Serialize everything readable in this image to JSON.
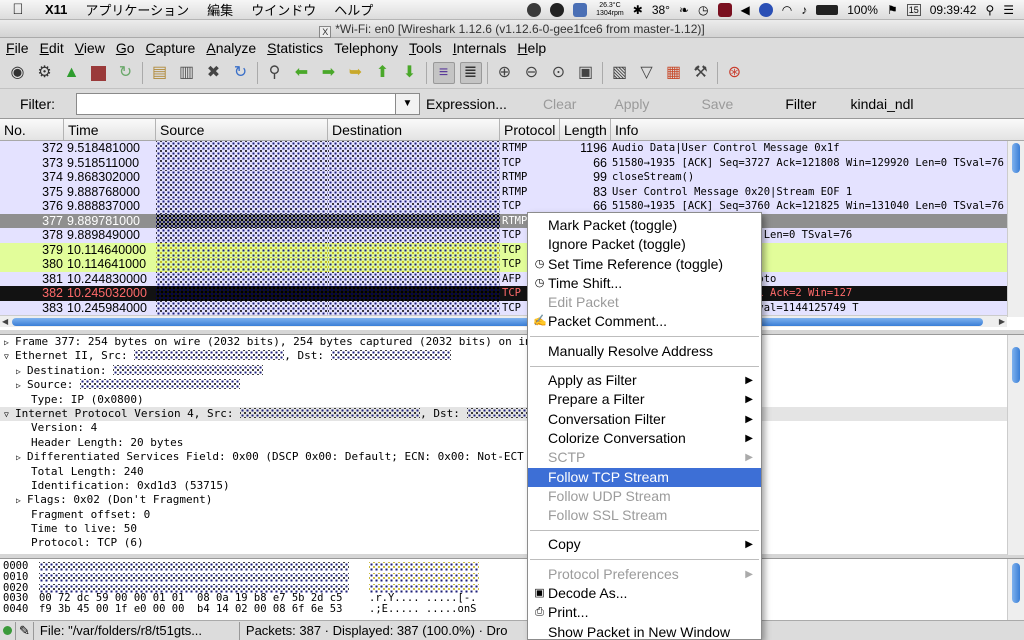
{
  "macbar": {
    "app_name": "X11",
    "menus": [
      "アプリケーション",
      "編集",
      "ウインドウ",
      "ヘルプ"
    ],
    "weather_temp": "26.3°C",
    "weather_wind": "1304rpm",
    "cpu_temp": "38°",
    "battery": "100%",
    "time": "09:39:42",
    "date_day": "15"
  },
  "title": "*Wi-Fi: en0   [Wireshark 1.12.6  (v1.12.6-0-gee1fce6 from master-1.12)]",
  "menubar": {
    "items": [
      {
        "key": "F",
        "rest": "ile"
      },
      {
        "key": "E",
        "rest": "dit"
      },
      {
        "key": "V",
        "rest": "iew"
      },
      {
        "key": "G",
        "rest": "o"
      },
      {
        "key": "C",
        "rest": "apture"
      },
      {
        "key": "A",
        "rest": "nalyze"
      },
      {
        "key": "S",
        "rest": "tatistics"
      },
      {
        "key": "",
        "rest": "Telephony"
      },
      {
        "key": "T",
        "rest": "ools"
      },
      {
        "key": "I",
        "rest": "nternals"
      },
      {
        "key": "H",
        "rest": "elp"
      }
    ]
  },
  "toolbar": {
    "icons": [
      "interface-list-icon",
      "capture-options-icon",
      "start-capture-icon",
      "stop-capture-icon",
      "restart-capture-icon",
      "open-file-icon",
      "save-file-icon",
      "close-file-icon",
      "reload-icon",
      "find-packet-icon",
      "go-back-icon",
      "go-forward-icon",
      "go-to-packet-icon",
      "go-first-icon",
      "go-last-icon",
      "colorize-icon",
      "autoscroll-icon",
      "zoom-in-icon",
      "zoom-out-icon",
      "zoom-normal-icon",
      "resize-columns-icon",
      "capture-filters-icon",
      "display-filters-icon",
      "coloring-rules-icon",
      "preferences-icon",
      "help-icon"
    ]
  },
  "filterbar": {
    "label": "Filter:",
    "value": "",
    "expression": "Expression...",
    "clear": "Clear",
    "apply": "Apply",
    "save": "Save",
    "filter_btn": "Filter",
    "saved_filter": "kindai_ndl"
  },
  "packet_list": {
    "columns": [
      "No.",
      "Time",
      "Source",
      "Destination",
      "Protocol",
      "Length",
      "Info"
    ],
    "rows": [
      {
        "no": "372",
        "time": "9.518481000",
        "proto": "RTMP",
        "len": "1196",
        "info": "Audio Data|User Control Message 0x1f",
        "bg": "#e4e2ff",
        "fg": "#000",
        "noise": "normal"
      },
      {
        "no": "373",
        "time": "9.518511000",
        "proto": "TCP",
        "len": "66",
        "info": "51580→1935 [ACK] Seq=3727 Ack=121808 Win=129920 Len=0 TSval=76",
        "bg": "#e4e2ff",
        "fg": "#000",
        "noise": "normal"
      },
      {
        "no": "374",
        "time": "9.868302000",
        "proto": "RTMP",
        "len": "99",
        "info": "closeStream()",
        "bg": "#e4e2ff",
        "fg": "#000",
        "noise": "normal"
      },
      {
        "no": "375",
        "time": "9.888768000",
        "proto": "RTMP",
        "len": "83",
        "info": "User Control Message 0x20|Stream EOF 1",
        "bg": "#e4e2ff",
        "fg": "#000",
        "noise": "normal"
      },
      {
        "no": "376",
        "time": "9.888837000",
        "proto": "TCP",
        "len": "66",
        "info": "51580→1935 [ACK] Seq=3760 Ack=121825 Win=131040 Len=0 TSval=76",
        "bg": "#e4e2ff",
        "fg": "#000",
        "noise": "normal"
      },
      {
        "no": "377",
        "time": "9.889781000",
        "proto": "RTMP",
        "len": "",
        "info": "y,Stop')",
        "bg": "#8f8f8f",
        "fg": "#fff",
        "noise": "dense"
      },
      {
        "no": "378",
        "time": "9.889849000",
        "proto": "TCP",
        "len": "",
        "info": "0 Ack=122013 Win=130880 Len=0 TSval=76",
        "bg": "#e4e2ff",
        "fg": "#000",
        "noise": "normal"
      },
      {
        "no": "379",
        "time": "10.114640000",
        "proto": "TCP",
        "len": "",
        "info": "k=1 Win=8192 Len=0",
        "bg": "#e2fd9a",
        "fg": "#000",
        "noise": "yel"
      },
      {
        "no": "380",
        "time": "10.114641000",
        "proto": "TCP",
        "len": "",
        "info": "k=1 Win=8192 Len=0",
        "bg": "#e2fd9a",
        "fg": "#000",
        "noise": "yel"
      },
      {
        "no": "381",
        "time": "10.244830000",
        "proto": "AFP",
        "len": "",
        "info": "st: Vol=1 Did=2 Name=photo",
        "bg": "#e4e2ff",
        "fg": "#000",
        "noise": "normal"
      },
      {
        "no": "382",
        "time": "10.245032000",
        "proto": "TCP",
        "len": "",
        "info": "nt] 80→51052 [ACK] Seq=1 Ack=2 Win=127",
        "bg": "#121212",
        "fg": "#ff6a6a",
        "noise": "dense"
      },
      {
        "no": "383",
        "time": "10.245984000",
        "proto": "TCP",
        "len": "",
        "info": "ck=41 Win=4094 Len=0 TSval=1144125749 T",
        "bg": "#e4e2ff",
        "fg": "#000",
        "noise": "normal"
      }
    ]
  },
  "details": {
    "frame": "Frame 377: 254 bytes on wire (2032 bits), 254 bytes captured (2032 bits) on inte",
    "eth_src": "Ethernet II, Src:",
    "eth_dst": "Dst:",
    "eth_dest": "Destination:",
    "eth_source": "Source:",
    "eth_type": "Type: IP (0x0800)",
    "ip_src": "Internet Protocol Version 4, Src:",
    "ip_dst": "Dst:",
    "version": "Version: 4",
    "header_len": "Header Length: 20 bytes",
    "dsfield": "Differentiated Services Field: 0x00 (DSCP 0x00: Default; ECN: 0x00: Not-ECT (",
    "total_len": "Total Length: 240",
    "ident": "Identification: 0xd1d3 (53715)",
    "flags": "Flags: 0x02 (Don't Fragment)",
    "frag": "Fragment offset: 0",
    "ttl": "Time to live: 50",
    "proto": "Protocol: TCP (6)"
  },
  "bytes": {
    "rows": [
      {
        "off": "0000",
        "hex": "",
        "asc": ""
      },
      {
        "off": "0010",
        "hex": "",
        "asc": ""
      },
      {
        "off": "0020",
        "hex": "",
        "asc": ""
      },
      {
        "off": "0030",
        "hex": "00 72 dc 59 00 00 01 01  08 0a 19 b8 e7 5b 2d c5",
        "asc": ".r.Y.... .....[-."
      },
      {
        "off": "0040",
        "hex": "f9 3b 45 00 1f e0 00 00  b4 14 02 00 08 6f 6e 53",
        "asc": ".;E..... .....onS"
      }
    ]
  },
  "statusbar": {
    "file": "File: \"/var/folders/r8/t51gts...",
    "packets": "Packets: 387 · Displayed: 387 (100.0%) · Dro"
  },
  "context_menu": {
    "items": [
      {
        "label": "Mark Packet (toggle)",
        "state": "enabled",
        "icon": "",
        "sub": false
      },
      {
        "label": "Ignore Packet (toggle)",
        "state": "enabled",
        "icon": "",
        "sub": false
      },
      {
        "label": "Set Time Reference (toggle)",
        "state": "enabled",
        "icon": "clock-icon",
        "sub": false
      },
      {
        "label": "Time Shift...",
        "state": "enabled",
        "icon": "clock-icon",
        "sub": false
      },
      {
        "label": "Edit Packet",
        "state": "disabled",
        "icon": "",
        "sub": false
      },
      {
        "label": "Packet Comment...",
        "state": "enabled",
        "icon": "comment-icon",
        "sub": false
      },
      {
        "sep": true
      },
      {
        "label": "Manually Resolve Address",
        "state": "enabled",
        "icon": "",
        "sub": false
      },
      {
        "sep": true
      },
      {
        "label": "Apply as Filter",
        "state": "enabled",
        "icon": "",
        "sub": true
      },
      {
        "label": "Prepare a Filter",
        "state": "enabled",
        "icon": "",
        "sub": true
      },
      {
        "label": "Conversation Filter",
        "state": "enabled",
        "icon": "",
        "sub": true
      },
      {
        "label": "Colorize Conversation",
        "state": "enabled",
        "icon": "",
        "sub": true
      },
      {
        "label": "SCTP",
        "state": "disabled",
        "icon": "",
        "sub": true
      },
      {
        "label": "Follow TCP Stream",
        "state": "active",
        "icon": "",
        "sub": false
      },
      {
        "label": "Follow UDP Stream",
        "state": "disabled",
        "icon": "",
        "sub": false
      },
      {
        "label": "Follow SSL Stream",
        "state": "disabled",
        "icon": "",
        "sub": false
      },
      {
        "sep": true
      },
      {
        "label": "Copy",
        "state": "enabled",
        "icon": "",
        "sub": true
      },
      {
        "sep": true
      },
      {
        "label": "Protocol Preferences",
        "state": "disabled",
        "icon": "",
        "sub": true
      },
      {
        "label": "Decode As...",
        "state": "enabled",
        "icon": "decode-icon",
        "sub": false
      },
      {
        "label": "Print...",
        "state": "enabled",
        "icon": "print-icon",
        "sub": false
      },
      {
        "label": "Show Packet in New Window",
        "state": "enabled",
        "icon": "",
        "sub": false
      }
    ]
  }
}
